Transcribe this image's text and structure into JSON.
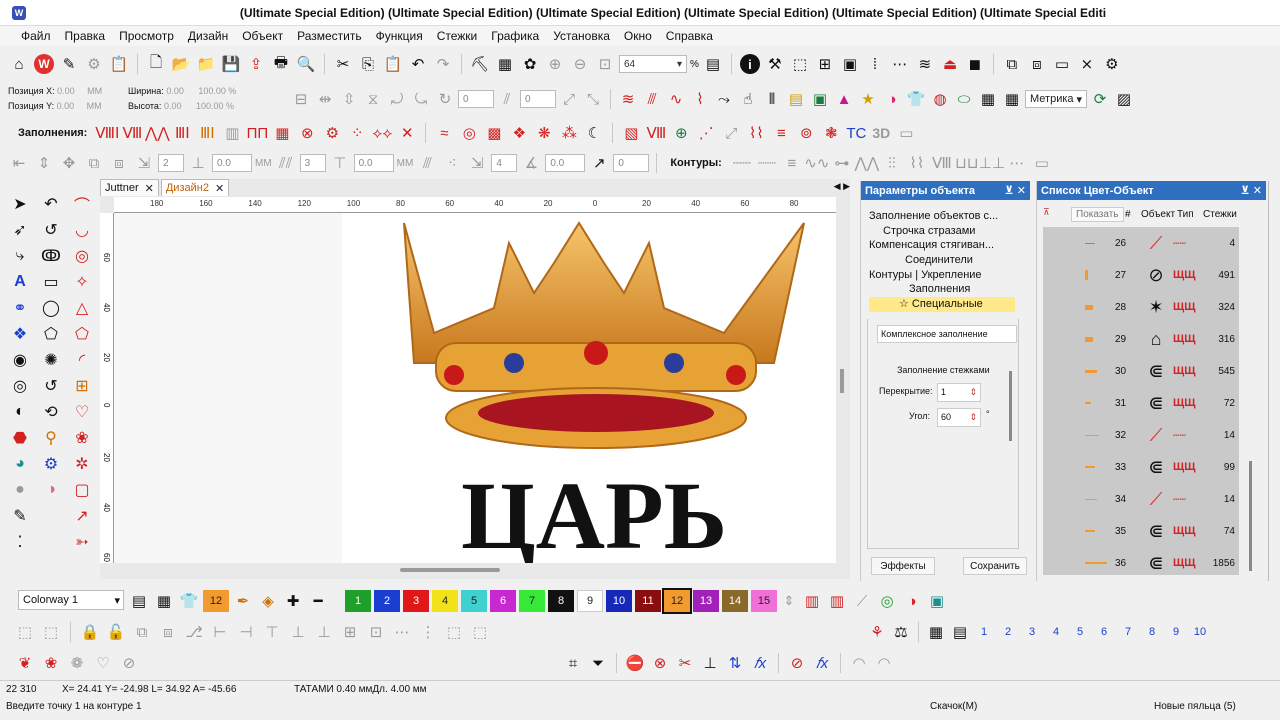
{
  "window": {
    "title": "(Ultimate Special Edition) (Ultimate Special Edition) (Ultimate Special Edition) (Ultimate Special Edition) (Ultimate Special Edition) (Ultimate Special Editi"
  },
  "menu": [
    "Файл",
    "Правка",
    "Просмотр",
    "Дизайн",
    "Объект",
    "Разместить",
    "Функция",
    "Стежки",
    "Графика",
    "Установка",
    "Окно",
    "Справка"
  ],
  "toolbar1": {
    "zoom_value": "64",
    "zoom_unit": "%"
  },
  "toolbar2": {
    "pos_x_label": "Позиция X:",
    "pos_x_value": "0.00",
    "pos_x_unit": "ММ",
    "pos_y_label": "Позиция Y:",
    "pos_y_value": "0.00",
    "pos_y_unit": "ММ",
    "width_label": "Ширина:",
    "width_value": "0.00",
    "width_pct": "100.00",
    "height_label": "Высота:",
    "height_value": "0.00",
    "height_pct": "100.00",
    "rot_value": "0",
    "slant_value": "0",
    "units_select": "Метрика"
  },
  "toolbar3": {
    "fills_label": "Заполнения:"
  },
  "toolbar4": {
    "v1": "2",
    "v2": "0.0",
    "u2": "ММ",
    "v3": "3",
    "v4": "0.0",
    "u4": "ММ",
    "v5": "4",
    "v6": "0.0",
    "v7": "0",
    "contours_label": "Контуры:"
  },
  "doc_tabs": [
    {
      "label": "Juttner"
    },
    {
      "label": "Дизайн2"
    }
  ],
  "hruler_ticks": [
    "180",
    "160",
    "140",
    "120",
    "100",
    "80",
    "60",
    "40",
    "20",
    "0",
    "20",
    "40",
    "60",
    "80"
  ],
  "vruler_ticks": [
    "60",
    "40",
    "20",
    "0",
    "20",
    "40",
    "60"
  ],
  "design_text": "ЦАРЬ",
  "params_panel": {
    "title": "Параметры объекта",
    "tree": [
      "Заполнение объектов с...",
      "Строчка стразами",
      "Компенсация стягиван...",
      "Соединители",
      "Контуры",
      "Укрепление",
      "Заполнения",
      "Специальные"
    ],
    "fill_type": "Комплексное заполнение",
    "section": "Заполнение стежками",
    "overlap_label": "Перекрытие:",
    "overlap_value": "1",
    "angle_label": "Угол:",
    "angle_value": "60",
    "angle_unit": "°",
    "effects_btn": "Эффекты",
    "save_btn": "Сохранить"
  },
  "color_list": {
    "title": "Список Цвет-Объект",
    "show_btn": "Показать",
    "headers": {
      "num": "#",
      "object": "Объект",
      "type": "Тип",
      "stitches": "Стежки"
    },
    "rows": [
      {
        "n": "26",
        "stitches": "4"
      },
      {
        "n": "27",
        "stitches": "491"
      },
      {
        "n": "28",
        "stitches": "324"
      },
      {
        "n": "29",
        "stitches": "316"
      },
      {
        "n": "30",
        "stitches": "545"
      },
      {
        "n": "31",
        "stitches": "72"
      },
      {
        "n": "32",
        "stitches": "14"
      },
      {
        "n": "33",
        "stitches": "99"
      },
      {
        "n": "34",
        "stitches": "14"
      },
      {
        "n": "35",
        "stitches": "74"
      },
      {
        "n": "36",
        "stitches": "1856"
      }
    ]
  },
  "colorway": {
    "value": "Colorway 1",
    "current_chip": "12"
  },
  "color_chips": [
    {
      "n": "1",
      "color": "#1ea02a"
    },
    {
      "n": "2",
      "color": "#1a3fd0"
    },
    {
      "n": "3",
      "color": "#e01818"
    },
    {
      "n": "4",
      "color": "#f2e21a"
    },
    {
      "n": "5",
      "color": "#3fd0d0"
    },
    {
      "n": "6",
      "color": "#c828d0"
    },
    {
      "n": "7",
      "color": "#38e838"
    },
    {
      "n": "8",
      "color": "#111111"
    },
    {
      "n": "9",
      "color": "#ffffff"
    },
    {
      "n": "10",
      "color": "#1628b8"
    },
    {
      "n": "11",
      "color": "#8a0e0e"
    },
    {
      "n": "12",
      "color": "#f29a2e"
    },
    {
      "n": "13",
      "color": "#a020b8"
    },
    {
      "n": "14",
      "color": "#8a6a2a"
    },
    {
      "n": "15",
      "color": "#f070d8"
    }
  ],
  "hoop_numbers": [
    "1",
    "2",
    "3",
    "4",
    "5",
    "6",
    "7",
    "8",
    "9",
    "10"
  ],
  "status": {
    "count": "22 310",
    "coords": "X= 24.41 Y= -24.98 L= 34.92 A= -45.66",
    "fill_info": "ТАТАМИ  0.40 ммДл. 4.00 мм",
    "prompt": "Введите точку 1 на контуре 1",
    "download": "Скачок(М)",
    "hoop": "Новые пяльца (5)"
  }
}
